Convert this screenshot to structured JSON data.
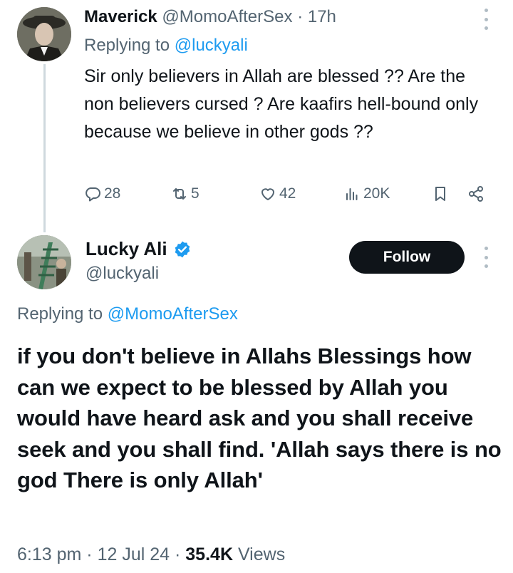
{
  "reply": {
    "display_name": "Maverick",
    "handle": "@MomoAfterSex",
    "separator": "·",
    "time": "17h",
    "replying_prefix": "Replying to",
    "replying_to": "@luckyali",
    "text": "Sir only believers in Allah are blessed ?? Are the non believers cursed ? Are kaafirs hell-bound only because we believe in other gods ??",
    "actions": {
      "replies": "28",
      "reposts": "5",
      "likes": "42",
      "views": "20K"
    },
    "icons": [
      "reply-icon",
      "repost-icon",
      "like-icon",
      "views-icon",
      "bookmark-icon",
      "share-icon",
      "more-icon"
    ]
  },
  "main": {
    "display_name": "Lucky Ali",
    "handle": "@luckyali",
    "verified": true,
    "follow_label": "Follow",
    "replying_prefix": "Replying to",
    "replying_to": "@MomoAfterSex",
    "text": "if you don't believe in Allahs Blessings how can we expect to be blessed by Allah  you would have heard ask and you shall receive seek and you shall find. 'Allah says there is no god There is only Allah'",
    "time": "6:13 pm",
    "date": "12 Jul 24",
    "views_count": "35.4K",
    "views_label": "Views",
    "separator": "·"
  },
  "colors": {
    "accent": "#1d9bf0",
    "text": "#0f1419",
    "secondary": "#536471",
    "button_bg": "#0f1419"
  }
}
